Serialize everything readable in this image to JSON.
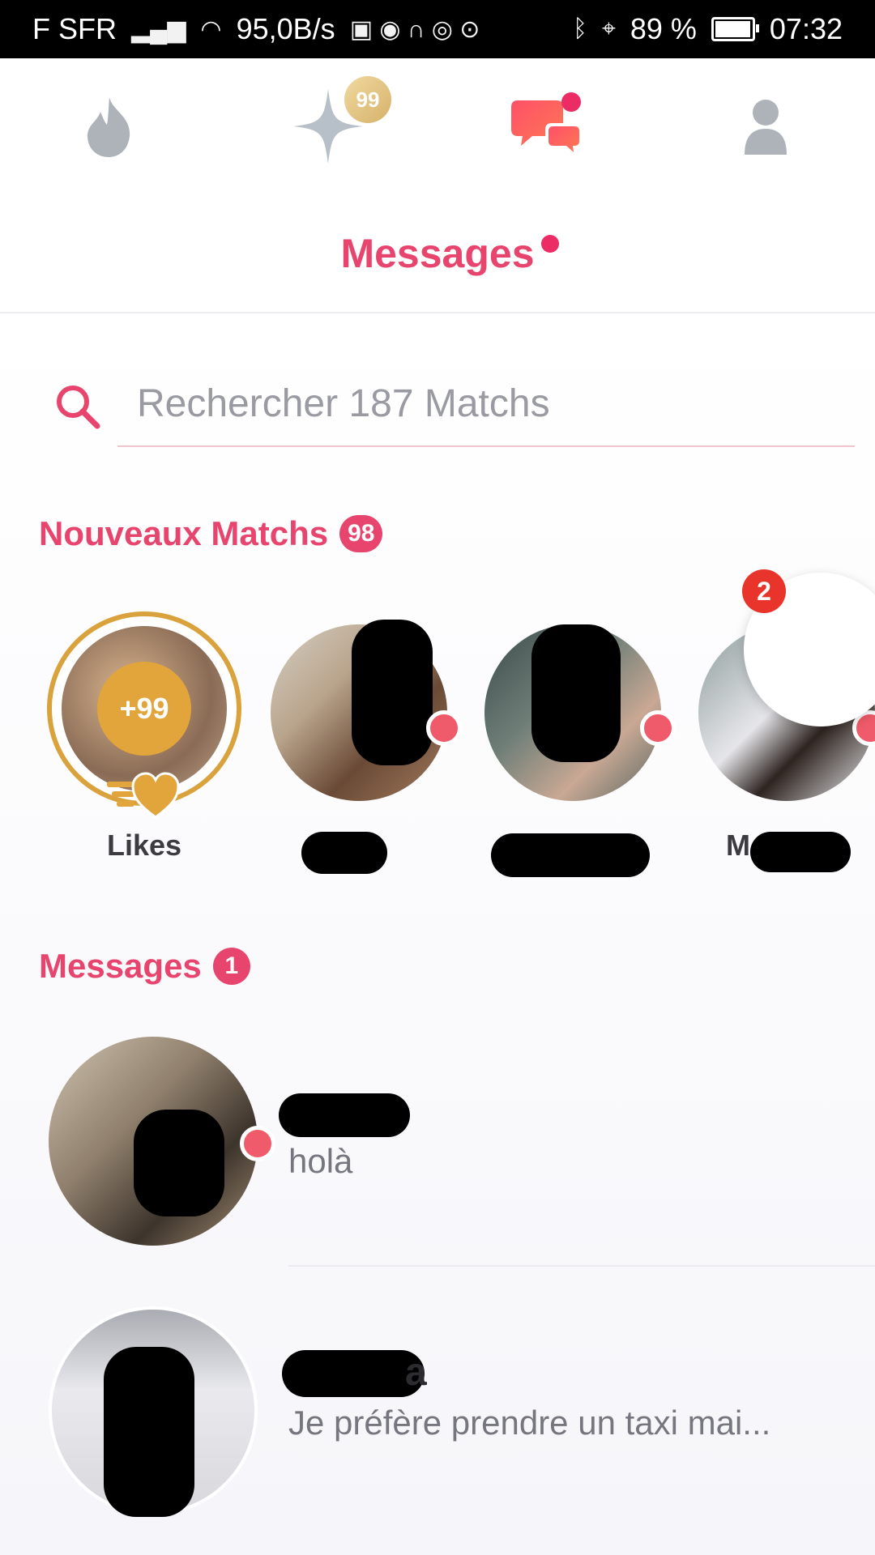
{
  "status_bar": {
    "carrier": "F SFR",
    "network_speed": "95,0B/s",
    "battery_percent": "89 %",
    "battery_level": 0.89,
    "time": "07:32"
  },
  "top_nav": {
    "items": [
      {
        "icon": "flame-icon",
        "active": false
      },
      {
        "icon": "sparkle-icon",
        "badge": "99"
      },
      {
        "icon": "chat-bubbles-icon",
        "active": true,
        "has_dot": true
      },
      {
        "icon": "profile-icon",
        "active": false
      }
    ]
  },
  "header": {
    "title": "Messages"
  },
  "search": {
    "placeholder": "Rechercher 187 Matchs"
  },
  "new_matches": {
    "title": "Nouveaux Matchs",
    "count": "98",
    "likes": {
      "count": "+99",
      "label": "Likes"
    },
    "items": [
      {
        "name_visible": "",
        "online": true
      },
      {
        "name_visible": "",
        "online": true
      },
      {
        "name_visible": "M",
        "online": true
      }
    ],
    "notification_count": "2"
  },
  "messages": {
    "title": "Messages",
    "count": "1",
    "items": [
      {
        "name_visible": "",
        "preview": "holà",
        "online": true
      },
      {
        "name_visible": "a",
        "preview": "Je préfère prendre un taxi mai...",
        "online": false
      }
    ]
  },
  "colors": {
    "accent": "#e7456d",
    "gold": "#d9a23c",
    "online": "#ef5b6a",
    "alert": "#e8342b"
  }
}
